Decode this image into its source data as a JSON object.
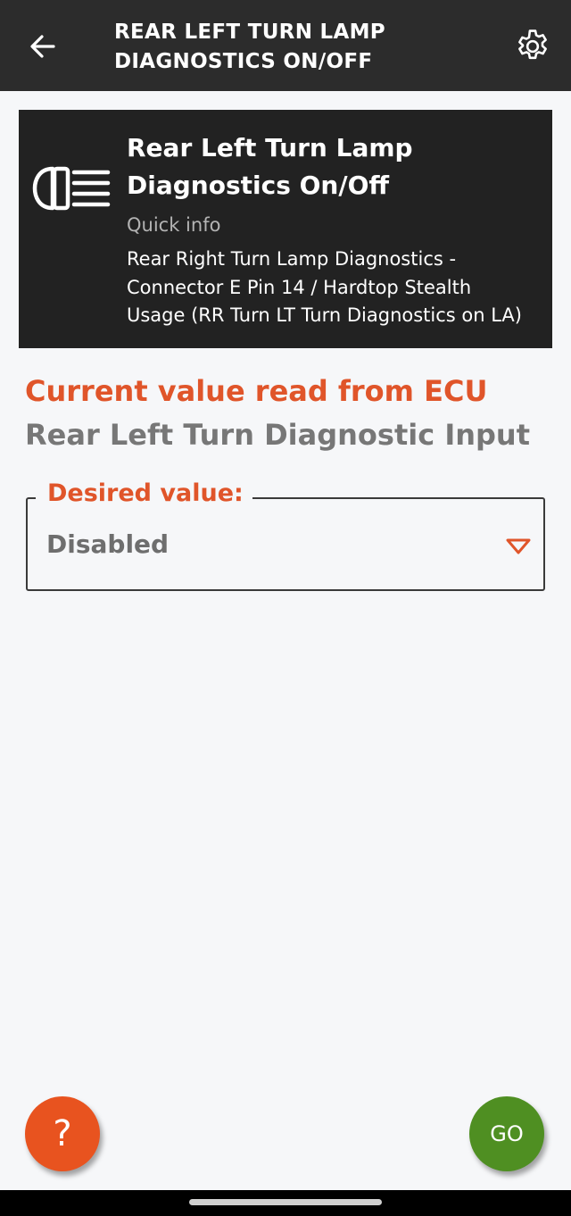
{
  "appbar": {
    "title_line1": "REAR LEFT TURN LAMP",
    "title_line2": "DIAGNOSTICS ON/OFF",
    "back_icon": "arrow-left-icon",
    "settings_icon": "gear-icon"
  },
  "card": {
    "icon": "headlamp-icon",
    "title_line1": "Rear Left Turn Lamp",
    "title_line2": "Diagnostics On/Off",
    "subtitle": "Quick info",
    "desc_line1": "Rear Right Turn Lamp Diagnostics -",
    "desc_line2": "Connector E Pin 14 / Hardtop Stealth",
    "desc_line3": "Usage (RR Turn LT Turn Diagnostics on LA)"
  },
  "current": {
    "label": "Current value read from ECU",
    "value": "Rear Left Turn Diagnostic Input"
  },
  "desired": {
    "legend": "Desired value:",
    "selected": "Disabled",
    "arrow_icon": "triangle-down-icon"
  },
  "fab": {
    "help_label": "?",
    "go_label": "GO"
  },
  "colors": {
    "accent": "#e0552a",
    "go": "#4f8f22",
    "appbar": "#2c2c2c"
  }
}
